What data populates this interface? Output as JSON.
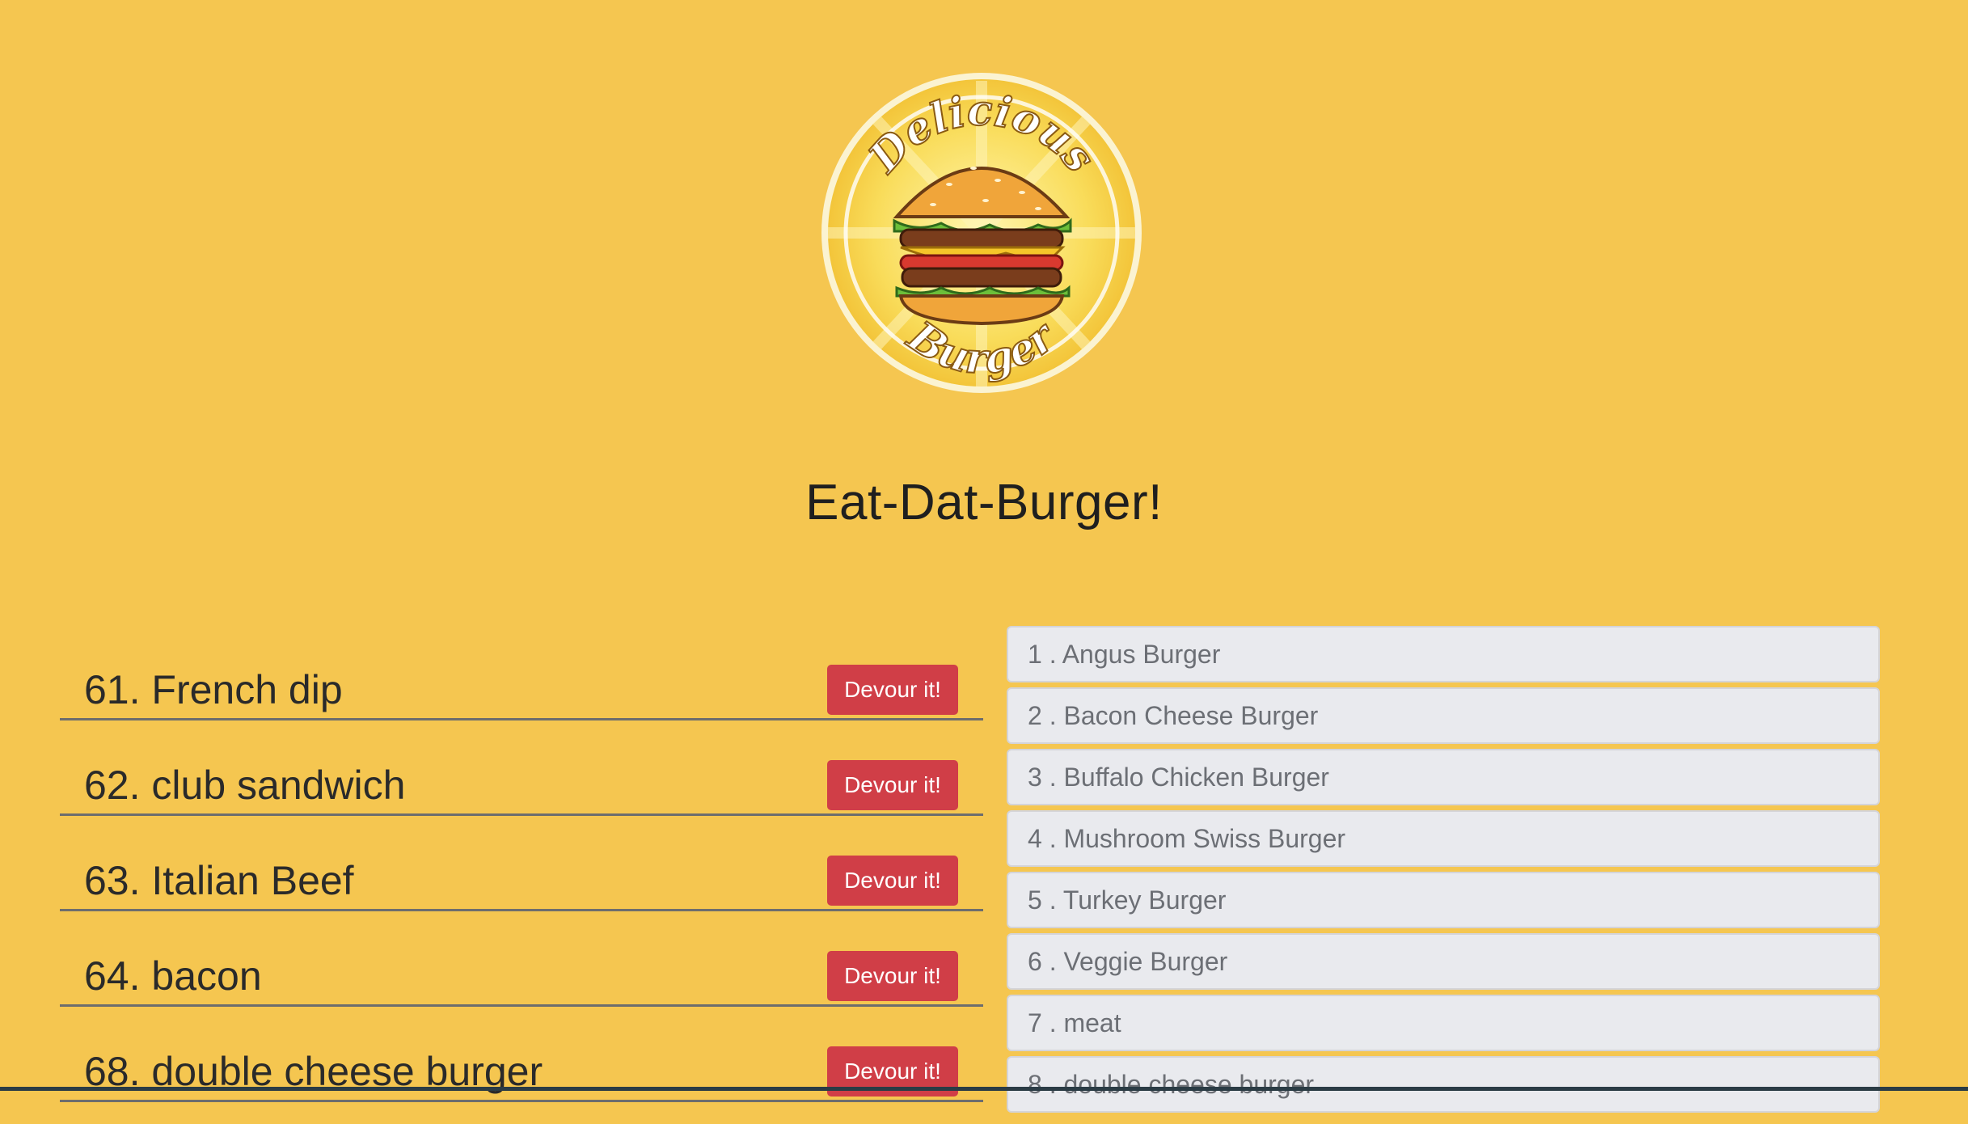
{
  "header": {
    "logo_top_text": "Delicious",
    "logo_bottom_text": "Burger",
    "title": "Eat-Dat-Burger!"
  },
  "uneaten_burgers": [
    {
      "label": "61. French dip",
      "button": "Devour it!"
    },
    {
      "label": "62. club sandwich",
      "button": "Devour it!"
    },
    {
      "label": "63. Italian Beef",
      "button": "Devour it!"
    },
    {
      "label": "64. bacon",
      "button": "Devour it!"
    },
    {
      "label": "68. double cheese burger",
      "button": "Devour it!"
    }
  ],
  "devoured_burgers": [
    {
      "label": "1 . Angus Burger"
    },
    {
      "label": "2 . Bacon Cheese Burger"
    },
    {
      "label": "3 . Buffalo Chicken Burger"
    },
    {
      "label": "4 . Mushroom Swiss Burger"
    },
    {
      "label": "5 . Turkey Burger"
    },
    {
      "label": "6 . Veggie Burger"
    },
    {
      "label": "7 . meat"
    },
    {
      "label": "8 . double cheese burger"
    }
  ],
  "colors": {
    "background": "#f5c650",
    "button": "#d03e47",
    "list_item_bg": "#e9eaee"
  },
  "icons": {
    "logo": "delicious-burger-logo-icon"
  }
}
